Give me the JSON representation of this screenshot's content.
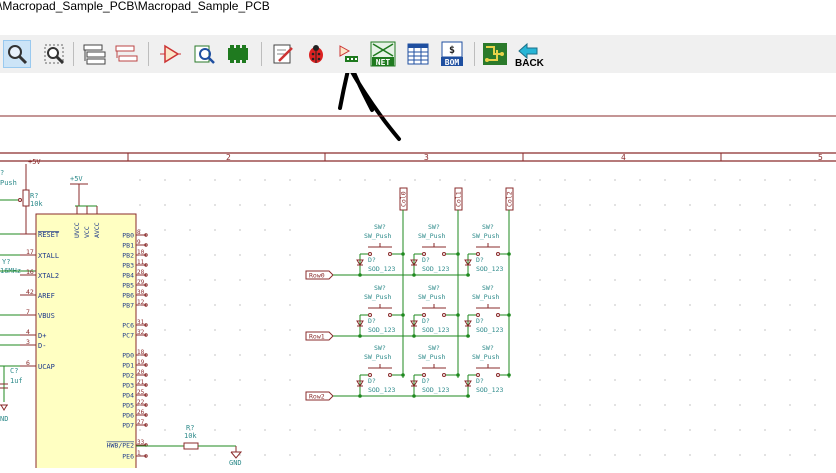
{
  "window": {
    "title": "\\Macropad_Sample_PCB\\Macropad_Sample_PCB"
  },
  "toolbar": {
    "buttons": [
      {
        "name": "zoom-select-icon"
      },
      {
        "name": "zoom-fit-icon"
      },
      {
        "name": "hierarchy-navigator-icon"
      },
      {
        "name": "leave-sheet-icon"
      },
      {
        "name": "symbol-editor-icon"
      },
      {
        "name": "symbol-browser-icon"
      },
      {
        "name": "footprint-editor-icon"
      },
      {
        "name": "annotate-icon"
      },
      {
        "name": "erc-bug-icon"
      },
      {
        "name": "assign-footprints-icon"
      },
      {
        "name": "netlist-icon",
        "label": "NET"
      },
      {
        "name": "bom-table-icon"
      },
      {
        "name": "bom-icon",
        "label": "BOM"
      },
      {
        "name": "pcbnew-icon"
      },
      {
        "name": "back-icon",
        "label": "BACK"
      }
    ]
  },
  "schematic": {
    "border_ruler": [
      "2",
      "3",
      "4",
      "5"
    ],
    "mcu_pins_left": [
      "RESET",
      "XTALL",
      "XTAL2",
      "AREF",
      "VBUS",
      "D+",
      "D-",
      "UCAP"
    ],
    "mcu_pin_numbers_left": [
      "17",
      "16",
      "42",
      "7",
      "4",
      "3",
      "6"
    ],
    "mcu_pins_right": [
      "PB0",
      "PB1",
      "PB2",
      "PB3",
      "PB4",
      "PB5",
      "PB6",
      "PB7",
      "PC6",
      "PC7",
      "PD0",
      "PD1",
      "PD2",
      "PD3",
      "PD4",
      "PD5",
      "PD6",
      "PD7",
      "HWB/PE2",
      "PE6"
    ],
    "mcu_pin_numbers_right": [
      "8",
      "9",
      "10",
      "11",
      "28",
      "29",
      "30",
      "12",
      "31",
      "32",
      "18",
      "19",
      "20",
      "21",
      "25",
      "22",
      "26",
      "27",
      "33",
      "1"
    ],
    "power_pins": [
      "UVCC",
      "VCC",
      "AVCC"
    ],
    "labels": {
      "plus5v_top": "+5V",
      "plus5v": "+5V",
      "gnd": "GND",
      "gnd_left": "ND",
      "r_top_ref": "R?",
      "r_top_val": "10k",
      "r_bottom_ref": "R?",
      "r_bottom_val": "10k",
      "cap_ref": "C?",
      "cap_val": "1uf",
      "crystal_ref": "Y?",
      "crystal_val": "16MHz",
      "push_frag": "Push",
      "q_frag": "?"
    },
    "switch_ref": "SW?",
    "switch_val": "SW_Push",
    "diode_ref": "D?",
    "diode_val": "SOD_123",
    "rows": [
      "Row0",
      "Row1",
      "Row2"
    ],
    "cols": [
      "Col0",
      "Col1",
      "Col2"
    ]
  }
}
